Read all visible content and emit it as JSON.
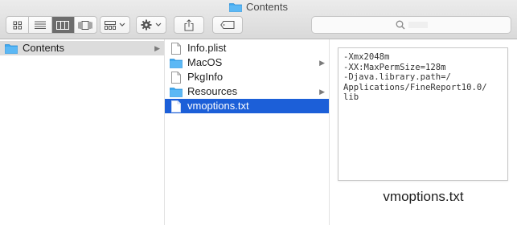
{
  "window": {
    "title": "Contents"
  },
  "toolbar": {
    "view_modes": [
      {
        "name": "icon-view-icon",
        "active": false
      },
      {
        "name": "list-view-icon",
        "active": false
      },
      {
        "name": "column-view-icon",
        "active": true
      },
      {
        "name": "cover-flow-icon",
        "active": false
      }
    ],
    "arrange_icon": "arrange-grid-icon",
    "action_icon": "gear-icon",
    "share_icon": "share-icon",
    "tag_icon": "tag-icon",
    "search_icon": "search-icon"
  },
  "column1": {
    "items": [
      {
        "label": "Contents",
        "type": "folder",
        "has_children": true,
        "selected": "gray"
      }
    ]
  },
  "column2": {
    "items": [
      {
        "label": "Info.plist",
        "type": "file",
        "has_children": false
      },
      {
        "label": "MacOS",
        "type": "folder",
        "has_children": true
      },
      {
        "label": "PkgInfo",
        "type": "file",
        "has_children": false
      },
      {
        "label": "Resources",
        "type": "folder",
        "has_children": true
      },
      {
        "label": "vmoptions.txt",
        "type": "file",
        "has_children": false,
        "selected": "blue"
      }
    ]
  },
  "preview": {
    "content": "-Xmx2048m\n-XX:MaxPermSize=128m\n-Djava.library.path=/\nApplications/FineReport10.0/\nlib",
    "filename": "vmoptions.txt"
  },
  "colors": {
    "folder_blue": "#3fa9f0",
    "selection_blue": "#1c5fd8",
    "selection_gray": "#dcdcdc"
  }
}
